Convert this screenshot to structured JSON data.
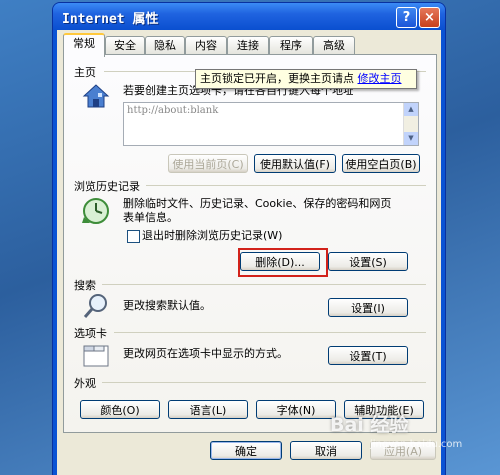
{
  "window": {
    "title": "Internet 属性",
    "help": "?",
    "close": "×"
  },
  "tabs": [
    "常规",
    "安全",
    "隐私",
    "内容",
    "连接",
    "程序",
    "高级"
  ],
  "home": {
    "heading": "主页",
    "text": "若要创建主页选项卡，请在各自行键入每个地址(R)。",
    "url": "http://about:blank",
    "buttons": {
      "current": "使用当前页(C)",
      "default": "使用默认值(F)",
      "blank": "使用空白页(B)"
    }
  },
  "tooltip": {
    "text": "主页锁定已开启，更换主页请点",
    "link": "修改主页"
  },
  "history": {
    "heading": "浏览历史记录",
    "text1": "删除临时文件、历史记录、Cookie、保存的密码和网页",
    "text2": "表单信息。",
    "checkbox": "退出时删除浏览历史记录(W)",
    "delete": "删除(D)...",
    "settings": "设置(S)"
  },
  "search": {
    "heading": "搜索",
    "text": "更改搜索默认值。",
    "settings": "设置(I)"
  },
  "tabsec": {
    "heading": "选项卡",
    "text": "更改网页在选项卡中显示的方式。",
    "settings": "设置(T)"
  },
  "appearance": {
    "heading": "外观",
    "colors": "颜色(O)",
    "languages": "语言(L)",
    "fonts": "字体(N)",
    "accessibility": "辅助功能(E)"
  },
  "footer": {
    "ok": "确定",
    "cancel": "取消",
    "apply": "应用(A)"
  },
  "watermark": {
    "main": "Bai 经验",
    "sub": "jingyan.baidu.com"
  }
}
